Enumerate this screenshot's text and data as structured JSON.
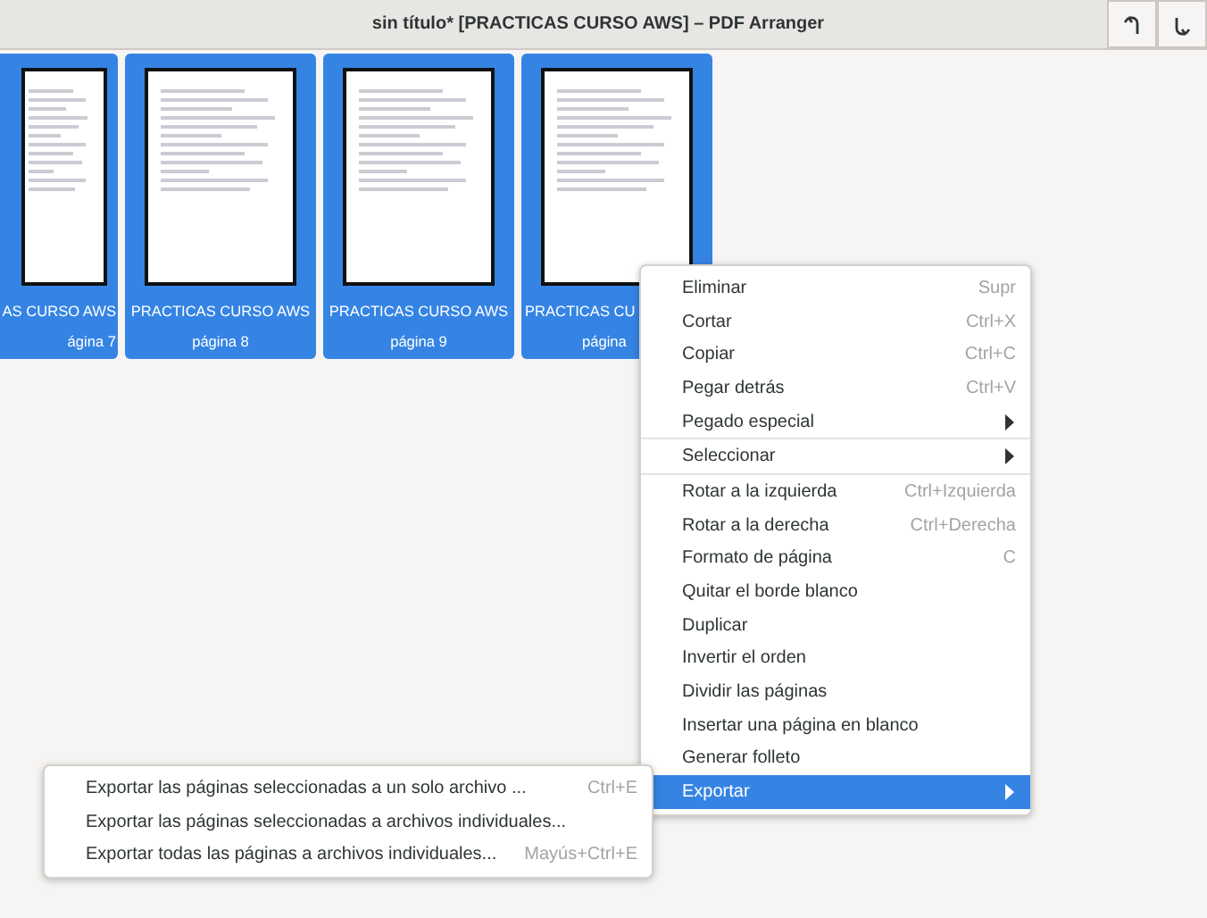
{
  "window": {
    "title": "sin título* [PRACTICAS CURSO AWS] – PDF Arranger"
  },
  "toolbar": {
    "buttons": [
      {
        "kind": "undo"
      },
      {
        "kind": "redo"
      }
    ]
  },
  "pages": [
    {
      "title": "AS CURSO AWS",
      "subtitle": "ágina 7",
      "selected": true
    },
    {
      "title": "PRACTICAS CURSO AWS",
      "subtitle": "página 8",
      "selected": true
    },
    {
      "title": "PRACTICAS CURSO AWS",
      "subtitle": "página 9",
      "selected": true
    },
    {
      "title": "PRACTICAS CU",
      "subtitle": "página",
      "selected": true
    }
  ],
  "context_menu": {
    "items": [
      {
        "label": "Eliminar",
        "shortcut": "Supr",
        "submenu": false,
        "selected": false,
        "separator_after": false
      },
      {
        "label": "Cortar",
        "shortcut": "Ctrl+X",
        "submenu": false,
        "selected": false,
        "separator_after": false
      },
      {
        "label": "Copiar",
        "shortcut": "Ctrl+C",
        "submenu": false,
        "selected": false,
        "separator_after": false
      },
      {
        "label": "Pegar detrás",
        "shortcut": "Ctrl+V",
        "submenu": false,
        "selected": false,
        "separator_after": false
      },
      {
        "label": "Pegado especial",
        "submenu": true,
        "selected": false,
        "separator_after": true
      },
      {
        "label": "Seleccionar",
        "submenu": true,
        "selected": false,
        "separator_after": true
      },
      {
        "label": "Rotar a la izquierda",
        "shortcut": "Ctrl+Izquierda",
        "submenu": false,
        "selected": false,
        "separator_after": false
      },
      {
        "label": "Rotar a la derecha",
        "shortcut": "Ctrl+Derecha",
        "submenu": false,
        "selected": false,
        "separator_after": false
      },
      {
        "label": "Formato de página",
        "shortcut": "C",
        "submenu": false,
        "selected": false,
        "separator_after": false
      },
      {
        "label": "Quitar el borde blanco",
        "submenu": false,
        "selected": false,
        "separator_after": false
      },
      {
        "label": "Duplicar",
        "submenu": false,
        "selected": false,
        "separator_after": false
      },
      {
        "label": "Invertir el orden",
        "submenu": false,
        "selected": false,
        "separator_after": false
      },
      {
        "label": "Dividir las páginas",
        "submenu": false,
        "selected": false,
        "separator_after": false
      },
      {
        "label": "Insertar una página en blanco",
        "submenu": false,
        "selected": false,
        "separator_after": false
      },
      {
        "label": "Generar folleto",
        "submenu": false,
        "selected": false,
        "separator_after": false
      },
      {
        "label": "Exportar",
        "submenu": true,
        "selected": true,
        "separator_after": false
      }
    ]
  },
  "export_submenu": {
    "items": [
      {
        "label": "Exportar las páginas seleccionadas a un solo archivo ...",
        "shortcut": "Ctrl+E",
        "selected": false
      },
      {
        "label": "Exportar las páginas seleccionadas a archivos individuales...",
        "selected": false
      },
      {
        "label": "Exportar todas las páginas a archivos individuales...",
        "shortcut": "Mayús+Ctrl+E",
        "selected": false
      }
    ]
  }
}
